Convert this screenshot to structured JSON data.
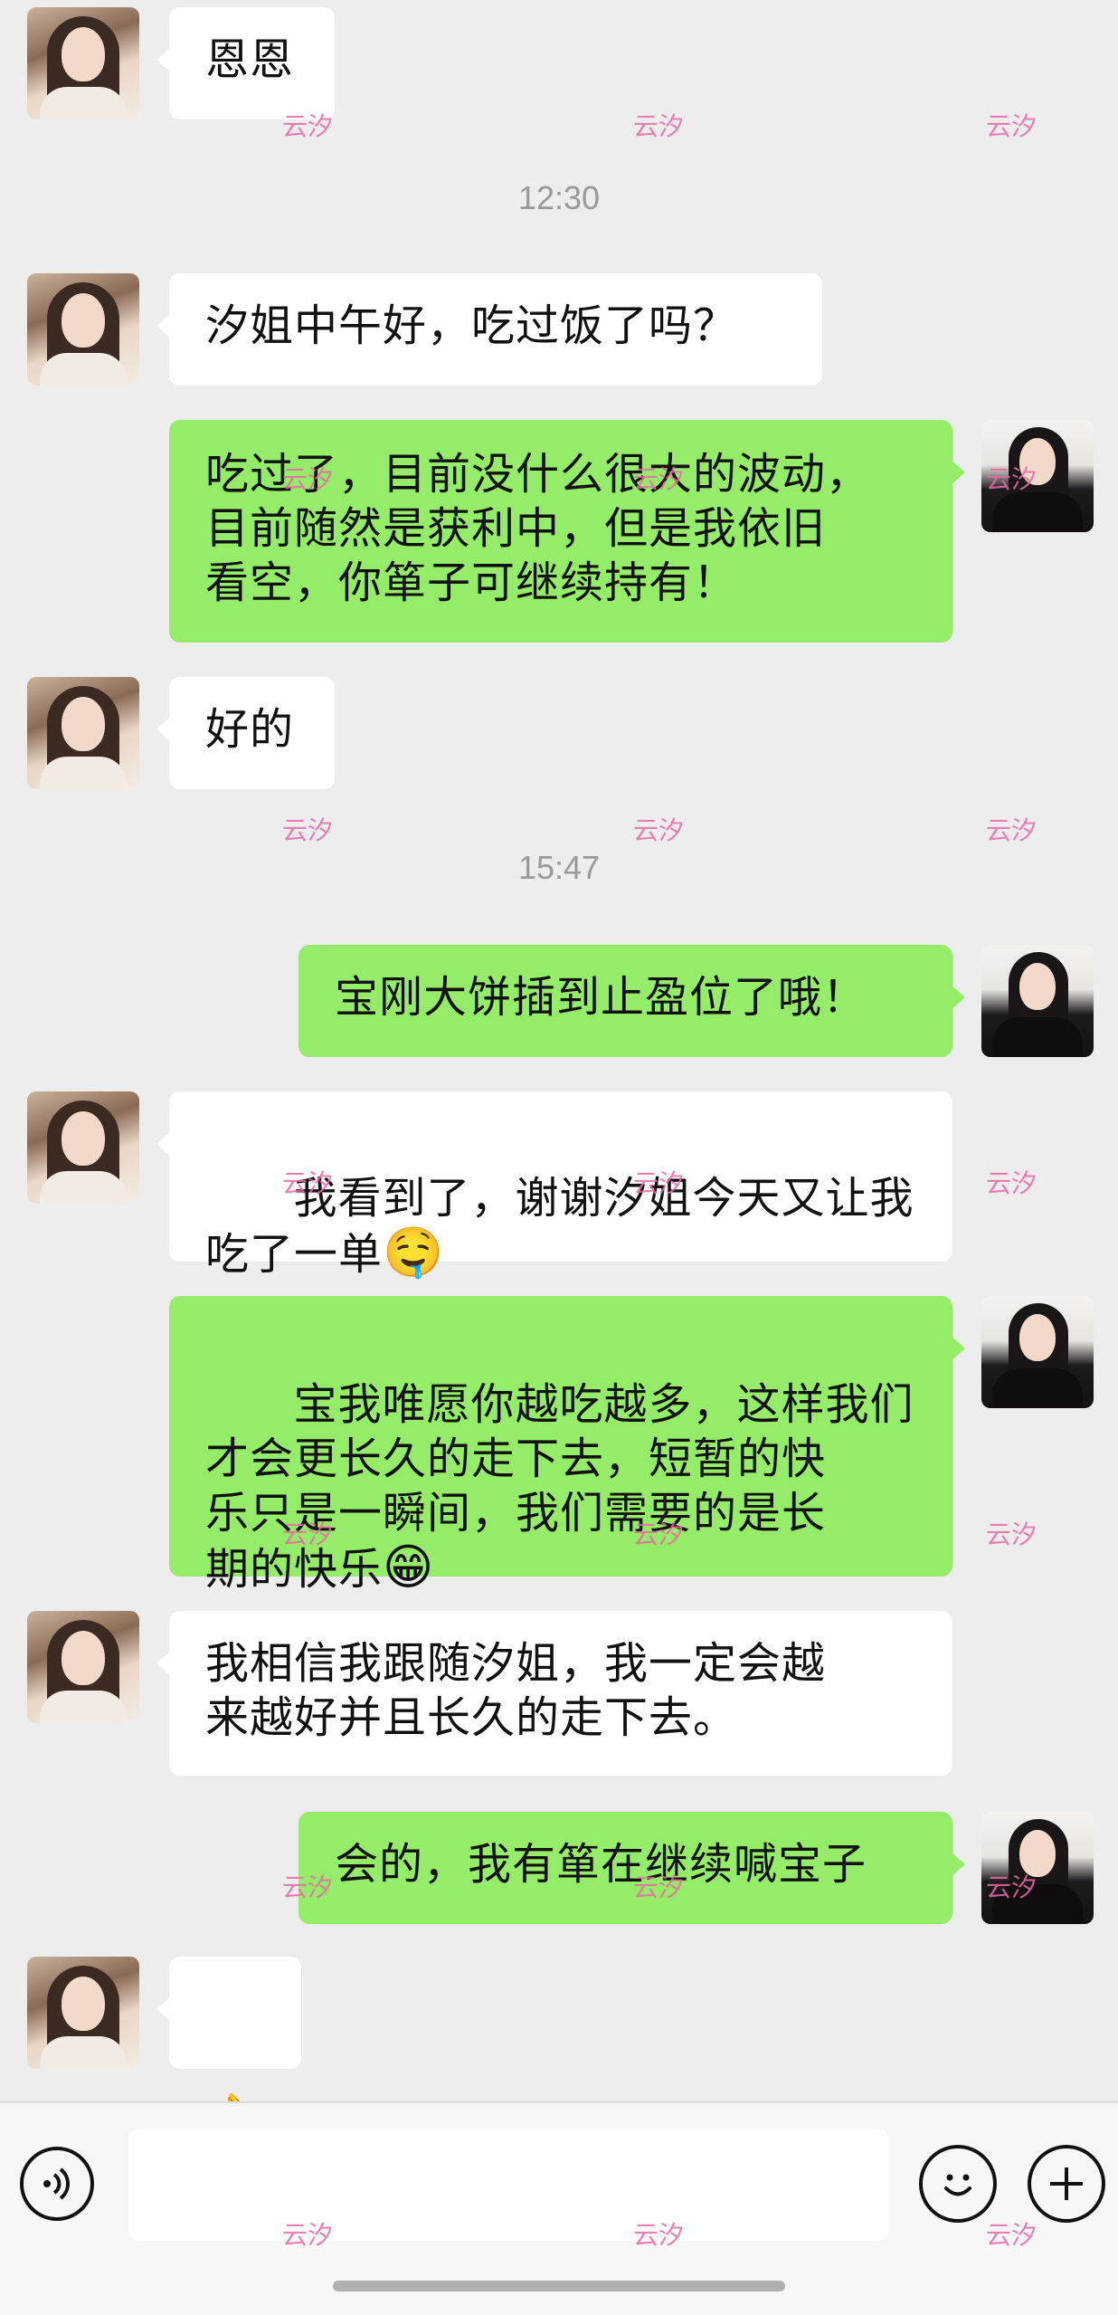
{
  "watermark": "云汐",
  "messages": [
    {
      "side": "left",
      "text": "恩恩"
    },
    {
      "type": "time",
      "text": "12:30"
    },
    {
      "side": "left",
      "text": "汐姐中午好，吃过饭了吗？"
    },
    {
      "side": "right",
      "text": "吃过了，目前没什么很大的波动，\n目前随然是获利中，但是我依旧\n看空，你箪子可继续持有！"
    },
    {
      "side": "left",
      "text": "好的"
    },
    {
      "type": "time",
      "text": "15:47"
    },
    {
      "side": "right",
      "text": "宝刚大饼插到止盈位了哦！"
    },
    {
      "side": "left",
      "text": "我看到了，谢谢汐姐今天又让我\n吃了一单",
      "emoji": "🤤"
    },
    {
      "side": "right",
      "text": "宝我唯愿你越吃越多，这样我们\n才会更长久的走下去，短暂的快\n乐只是一瞬间，我们需要的是长\n期的快乐",
      "emoji": "😁"
    },
    {
      "side": "left",
      "text": "我相信我跟随汐姐，我一定会越\n来越好并且长久的走下去。"
    },
    {
      "side": "right",
      "text": "会的，我有箪在继续喊宝子"
    },
    {
      "side": "left",
      "text": "",
      "emoji": "👌"
    }
  ],
  "input_bar": {
    "voice_icon": "voice-icon",
    "emoji_icon": "emoji-icon",
    "plus_icon": "plus-icon",
    "text_value": ""
  }
}
